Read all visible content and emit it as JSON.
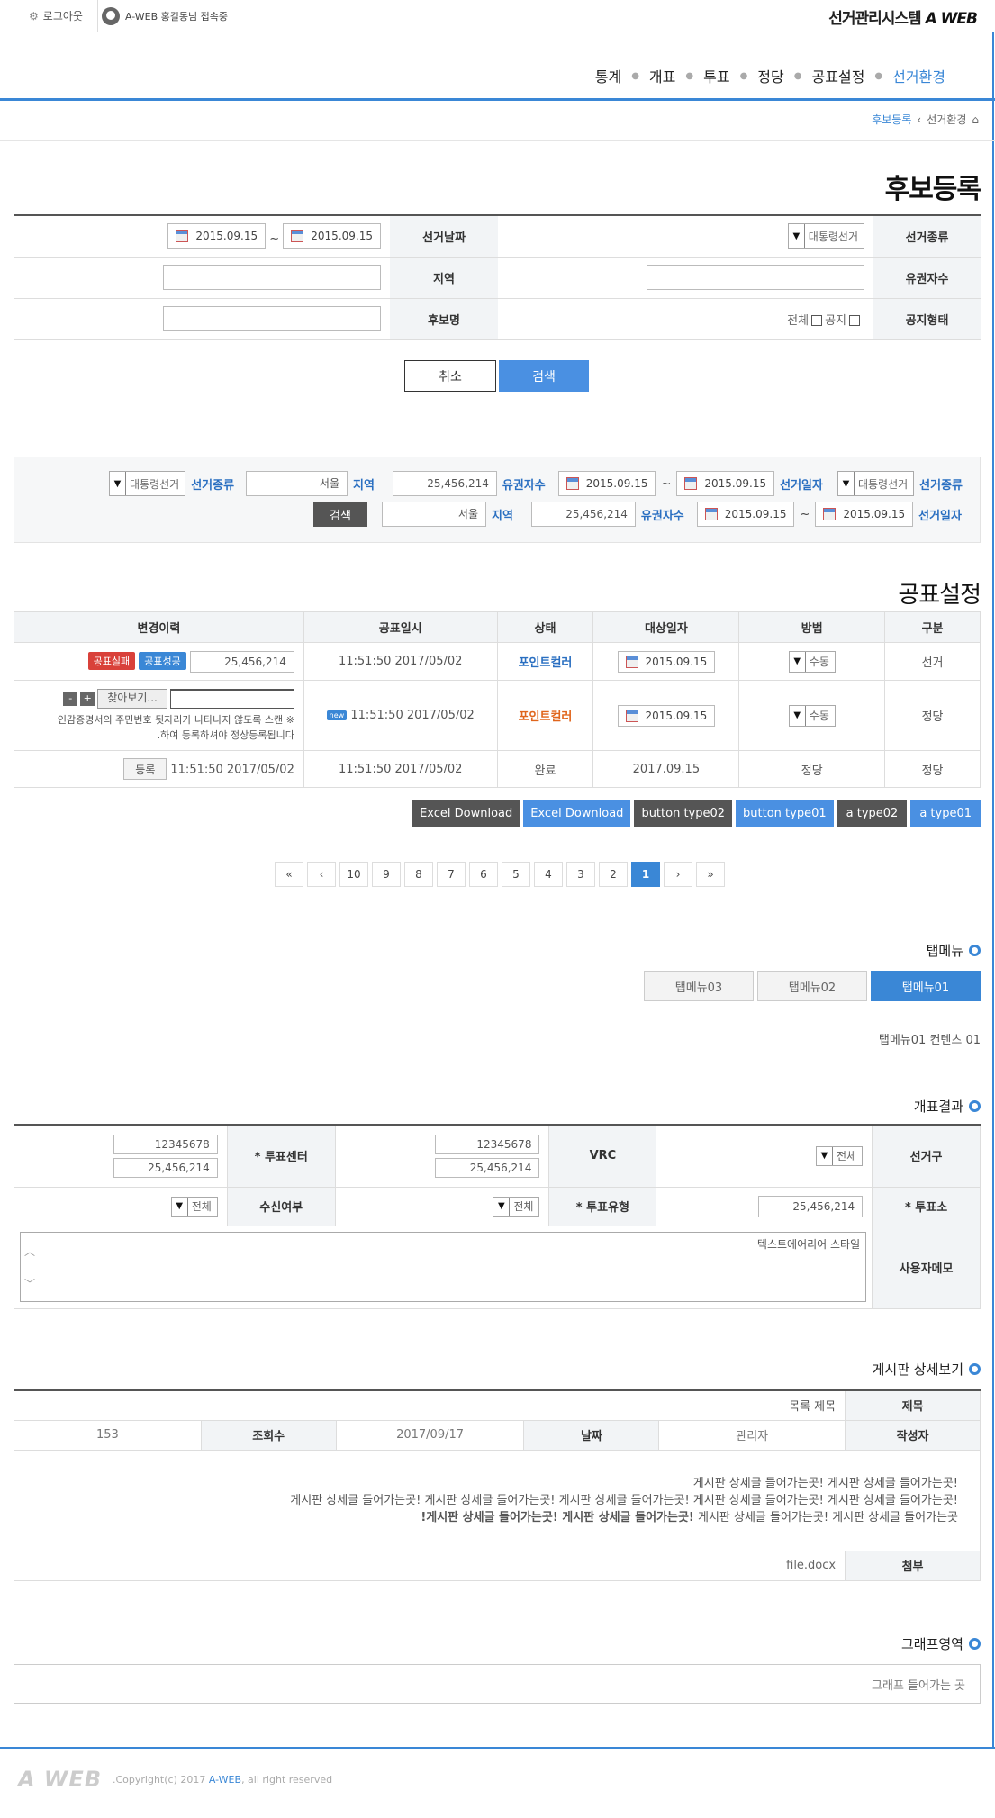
{
  "top": {
    "logout": "로그아웃",
    "user": "A-WEB 홍길동님 접속중",
    "system": "선거관리시스템",
    "system_brand": "A WEB"
  },
  "gnb": [
    "통계",
    "개표",
    "투표",
    "정당",
    "공표설정",
    "선거환경"
  ],
  "breadcrumb": {
    "current": "후보등록",
    "parent": "선거환경"
  },
  "page_title": "후보등록",
  "form": {
    "date_label": "선거날짜",
    "date_from": "2015.09.15",
    "date_tilde": "~",
    "date_to": "2015.09.15",
    "type_label": "선거종류",
    "type_value": "대통령선거",
    "region_label": "지역",
    "voters_label": "유권자수",
    "name_label": "후보명",
    "notice_label": "공지형태",
    "notice_all": "전체",
    "notice_item": "공지",
    "cancel": "취소",
    "search": "검색"
  },
  "search2": {
    "type_value": "대통령선거",
    "type_label": "선거종류",
    "region_value": "서울",
    "region_label": "지역",
    "voters_value": "25,456,214",
    "voters_label": "유권자수",
    "date_from": "2015.09.15",
    "date_tilde": "~",
    "date_to": "2015.09.15",
    "date_label": "선거일자",
    "search": "검색"
  },
  "section_title": "공표설정",
  "list": {
    "headers": [
      "변경이력",
      "공표일시",
      "상태",
      "대상일자",
      "방법",
      "구분"
    ],
    "row1": {
      "badge_fail": "공표실패",
      "badge_ok": "공표성공",
      "value": "25,456,214",
      "time": "11:51:50 2017/05/02",
      "status": "포인트컬러",
      "date": "2015.09.15",
      "method": "수동",
      "kind": "선거"
    },
    "row2": {
      "minus": "-",
      "plus": "+",
      "browse": "찾아보기...",
      "note1": "인감증명서의 주민번호 뒷자리가 나타나지 않도록 스캔 ※",
      "note2": ".하여 등록하셔야 정상등록됩니다",
      "new": "new",
      "time": "11:51:50 2017/05/02",
      "status": "포인트컬러",
      "date": "2015.09.15",
      "method": "수동",
      "kind": "정당"
    },
    "row3": {
      "reg": "등록",
      "reg_time": "11:51:50 2017/05/02",
      "time": "11:51:50 2017/05/02",
      "status": "완료",
      "date": "2017.09.15",
      "method": "정당",
      "kind": "정당"
    }
  },
  "buttons": [
    "Excel Download",
    "Excel Download",
    "button type02",
    "button type01",
    "a type02",
    "a type01"
  ],
  "pagination": [
    "«",
    "‹",
    "10",
    "9",
    "8",
    "7",
    "6",
    "5",
    "4",
    "3",
    "2",
    "1",
    "›",
    "»"
  ],
  "tabmenu": {
    "title": "탭메뉴",
    "tabs": [
      "탭메뉴03",
      "탭메뉴02",
      "탭메뉴01"
    ],
    "content": "탭메뉴01 컨텐츠 01"
  },
  "count": {
    "title": "개표결과",
    "center_label": "투표센터",
    "center_v1": "12345678",
    "center_v2": "25,456,214",
    "vrc_label": "VRC",
    "vrc_v1": "12345678",
    "vrc_v2": "25,456,214",
    "district_label": "선거구",
    "district_value": "전체",
    "recv_label": "수신여부",
    "recv_value": "전체",
    "vtype_label": "투표유형",
    "vtype_value": "전체",
    "station_label": "투표소",
    "station_value": "25,456,214",
    "memo_label": "사용자메모",
    "memo_placeholder": "텍스트에어리어 스타일"
  },
  "board": {
    "title": "게시판 상세보기",
    "subject_label": "제목",
    "subject": "목록 제목",
    "author_label": "작성자",
    "author": "관리자",
    "date_label": "날짜",
    "date": "2017/09/17",
    "views_label": "조회수",
    "views": "153",
    "body1": "게시판 상세글 들어가는곳! 게시판 상세글 들어가는곳!",
    "body2": "게시판 상세글 들어가는곳! 게시판 상세글 들어가는곳! 게시판 상세글 들어가는곳! 게시판 상세글 들어가는곳! 게시판 상세글 들어가는곳!",
    "body3_bold": "!게시판 상세글 들어가는곳! 게시판 상세글 들어가는곳!",
    "body3_rest": " 게시판 상세글 들어가는곳! 게시판 상세글 들어가는곳",
    "attach_label": "첨부",
    "attach": "file.docx"
  },
  "graph": {
    "title": "그래프영역",
    "placeholder": "그래프 들어가는 곳"
  },
  "footer": {
    "logo": "A WEB",
    "copy_prefix": ".Copyright(c) 2017 ",
    "copy_brand": "A-WEB",
    "copy_suffix": ", all right reserved"
  }
}
